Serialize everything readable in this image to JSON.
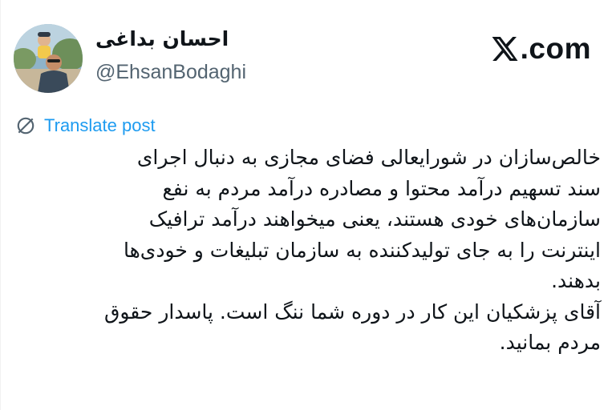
{
  "author": {
    "display_name": "احسان بداغی",
    "handle": "@EhsanBodaghi",
    "avatar_icon": "profile-photo"
  },
  "brand": {
    "label": ".com",
    "icon": "x-logo-icon"
  },
  "translate": {
    "label": "Translate post",
    "icon": "globe-slash-icon",
    "color": "#1d9bf0"
  },
  "tweet": {
    "lines": [
      "خالص‌سازان در شورایعالی فضای مجازی به دنبال اجرای",
      "سند تسهیم درآمد محتوا و مصادره درآمد مردم به نفع",
      "سازمان‌های خودی هستند، یعنی میخواهند درآمد ترافیک",
      "اینترنت را به جای تولیدکننده به سازمان تبلیغات و خودی‌ها",
      "بدهند.",
      "آقای پزشکیان این کار در دوره شما ننگ است. پاسدار حقوق",
      "مردم بمانید."
    ]
  }
}
